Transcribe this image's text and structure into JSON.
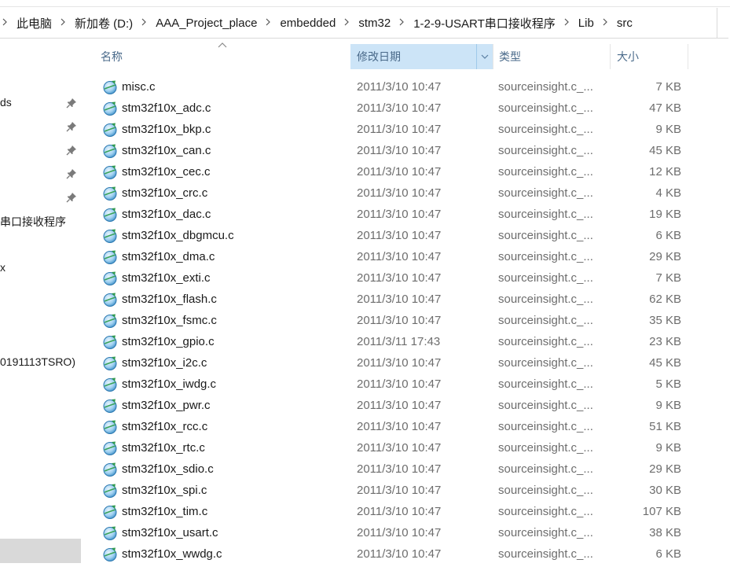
{
  "breadcrumb": [
    "此电脑",
    "新加卷 (D:)",
    "AAA_Project_place",
    "embedded",
    "stm32",
    "1-2-9-USART串口接收程序",
    "Lib",
    "src"
  ],
  "nav": {
    "items": [
      {
        "label": "ds",
        "pinned": true
      },
      {
        "label": "",
        "pinned": true
      },
      {
        "label": "",
        "pinned": true
      },
      {
        "label": "",
        "pinned": true
      },
      {
        "label": "",
        "pinned": true
      },
      {
        "label": "串口接收程序",
        "pinned": false
      },
      {
        "label": "x",
        "pinned": false
      },
      {
        "label": "0191113TSRO)",
        "pinned": false
      }
    ]
  },
  "columns": {
    "name": "名称",
    "date": "修改日期",
    "type": "类型",
    "size": "大小"
  },
  "files": [
    {
      "name": "misc.c",
      "date": "2011/3/10 10:47",
      "type": "sourceinsight.c_...",
      "size": "7 KB"
    },
    {
      "name": "stm32f10x_adc.c",
      "date": "2011/3/10 10:47",
      "type": "sourceinsight.c_...",
      "size": "47 KB"
    },
    {
      "name": "stm32f10x_bkp.c",
      "date": "2011/3/10 10:47",
      "type": "sourceinsight.c_...",
      "size": "9 KB"
    },
    {
      "name": "stm32f10x_can.c",
      "date": "2011/3/10 10:47",
      "type": "sourceinsight.c_...",
      "size": "45 KB"
    },
    {
      "name": "stm32f10x_cec.c",
      "date": "2011/3/10 10:47",
      "type": "sourceinsight.c_...",
      "size": "12 KB"
    },
    {
      "name": "stm32f10x_crc.c",
      "date": "2011/3/10 10:47",
      "type": "sourceinsight.c_...",
      "size": "4 KB"
    },
    {
      "name": "stm32f10x_dac.c",
      "date": "2011/3/10 10:47",
      "type": "sourceinsight.c_...",
      "size": "19 KB"
    },
    {
      "name": "stm32f10x_dbgmcu.c",
      "date": "2011/3/10 10:47",
      "type": "sourceinsight.c_...",
      "size": "6 KB"
    },
    {
      "name": "stm32f10x_dma.c",
      "date": "2011/3/10 10:47",
      "type": "sourceinsight.c_...",
      "size": "29 KB"
    },
    {
      "name": "stm32f10x_exti.c",
      "date": "2011/3/10 10:47",
      "type": "sourceinsight.c_...",
      "size": "7 KB"
    },
    {
      "name": "stm32f10x_flash.c",
      "date": "2011/3/10 10:47",
      "type": "sourceinsight.c_...",
      "size": "62 KB"
    },
    {
      "name": "stm32f10x_fsmc.c",
      "date": "2011/3/10 10:47",
      "type": "sourceinsight.c_...",
      "size": "35 KB"
    },
    {
      "name": "stm32f10x_gpio.c",
      "date": "2011/3/11 17:43",
      "type": "sourceinsight.c_...",
      "size": "23 KB"
    },
    {
      "name": "stm32f10x_i2c.c",
      "date": "2011/3/10 10:47",
      "type": "sourceinsight.c_...",
      "size": "45 KB"
    },
    {
      "name": "stm32f10x_iwdg.c",
      "date": "2011/3/10 10:47",
      "type": "sourceinsight.c_...",
      "size": "5 KB"
    },
    {
      "name": "stm32f10x_pwr.c",
      "date": "2011/3/10 10:47",
      "type": "sourceinsight.c_...",
      "size": "9 KB"
    },
    {
      "name": "stm32f10x_rcc.c",
      "date": "2011/3/10 10:47",
      "type": "sourceinsight.c_...",
      "size": "51 KB"
    },
    {
      "name": "stm32f10x_rtc.c",
      "date": "2011/3/10 10:47",
      "type": "sourceinsight.c_...",
      "size": "9 KB"
    },
    {
      "name": "stm32f10x_sdio.c",
      "date": "2011/3/10 10:47",
      "type": "sourceinsight.c_...",
      "size": "29 KB"
    },
    {
      "name": "stm32f10x_spi.c",
      "date": "2011/3/10 10:47",
      "type": "sourceinsight.c_...",
      "size": "30 KB"
    },
    {
      "name": "stm32f10x_tim.c",
      "date": "2011/3/10 10:47",
      "type": "sourceinsight.c_...",
      "size": "107 KB"
    },
    {
      "name": "stm32f10x_usart.c",
      "date": "2011/3/10 10:47",
      "type": "sourceinsight.c_...",
      "size": "38 KB"
    },
    {
      "name": "stm32f10x_wwdg.c",
      "date": "2011/3/10 10:47",
      "type": "sourceinsight.c_...",
      "size": "6 KB"
    }
  ],
  "icons": {
    "file": "source-file-icon",
    "pin": "pin-icon",
    "sort": "sort-up-icon",
    "dropdown": "chevron-down-icon",
    "separator": "chevron-right-icon"
  },
  "colors": {
    "sorted_header_bg": "#cce4f7",
    "header_text": "#4a6a8a",
    "detail_text": "#6d6d6d",
    "nav_selected_bg": "#d9d9d9"
  }
}
